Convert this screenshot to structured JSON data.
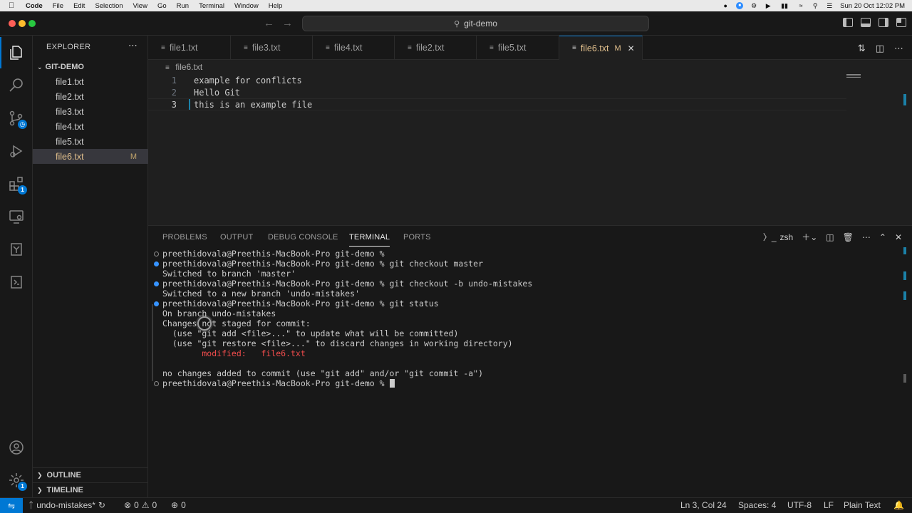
{
  "menubar": {
    "items": [
      "Code",
      "File",
      "Edit",
      "Selection",
      "View",
      "Go",
      "Run",
      "Terminal",
      "Window",
      "Help"
    ],
    "clock": "Sun 20 Oct  12:02 PM"
  },
  "titlebar": {
    "search_text": "git-demo"
  },
  "activity": {
    "extensions_badge": "1",
    "settings_badge": "1"
  },
  "sidebar": {
    "title": "EXPLORER",
    "folder": "GIT-DEMO",
    "files": [
      {
        "name": "file1.txt",
        "status": ""
      },
      {
        "name": "file2.txt",
        "status": ""
      },
      {
        "name": "file3.txt",
        "status": ""
      },
      {
        "name": "file4.txt",
        "status": ""
      },
      {
        "name": "file5.txt",
        "status": ""
      },
      {
        "name": "file6.txt",
        "status": "M"
      }
    ],
    "outline": "OUTLINE",
    "timeline": "TIMELINE"
  },
  "tabs": [
    {
      "label": "file1.txt"
    },
    {
      "label": "file3.txt"
    },
    {
      "label": "file4.txt"
    },
    {
      "label": "file2.txt"
    },
    {
      "label": "file5.txt"
    },
    {
      "label": "file6.txt",
      "status": "M"
    }
  ],
  "editor": {
    "breadcrumb": "file6.txt",
    "lines": [
      {
        "num": "1",
        "text": "example for conflicts"
      },
      {
        "num": "2",
        "text": "Hello Git"
      },
      {
        "num": "3",
        "text": "this is an example file"
      }
    ]
  },
  "panel": {
    "tabs": [
      "PROBLEMS",
      "OUTPUT",
      "DEBUG CONSOLE",
      "TERMINAL",
      "PORTS"
    ],
    "shell": "zsh",
    "terminal_lines": [
      "preethidovala@Preethis-MacBook-Pro git-demo %",
      "preethidovala@Preethis-MacBook-Pro git-demo % git checkout master",
      "Switched to branch 'master'",
      "preethidovala@Preethis-MacBook-Pro git-demo % git checkout -b undo-mistakes",
      "Switched to a new branch 'undo-mistakes'",
      "preethidovala@Preethis-MacBook-Pro git-demo % git status",
      "On branch undo-mistakes",
      "Changes not staged for commit:",
      "  (use \"git add <file>...\" to update what will be committed)",
      "  (use \"git restore <file>...\" to discard changes in working directory)",
      "        modified:   file6.txt",
      "",
      "no changes added to commit (use \"git add\" and/or \"git commit -a\")",
      "preethidovala@Preethis-MacBook-Pro git-demo % "
    ]
  },
  "statusbar": {
    "branch": "undo-mistakes*",
    "errors": "0",
    "warnings": "0",
    "ports": "0",
    "position": "Ln 3, Col 24",
    "spaces": "Spaces: 4",
    "encoding": "UTF-8",
    "eol": "LF",
    "language": "Plain Text"
  }
}
